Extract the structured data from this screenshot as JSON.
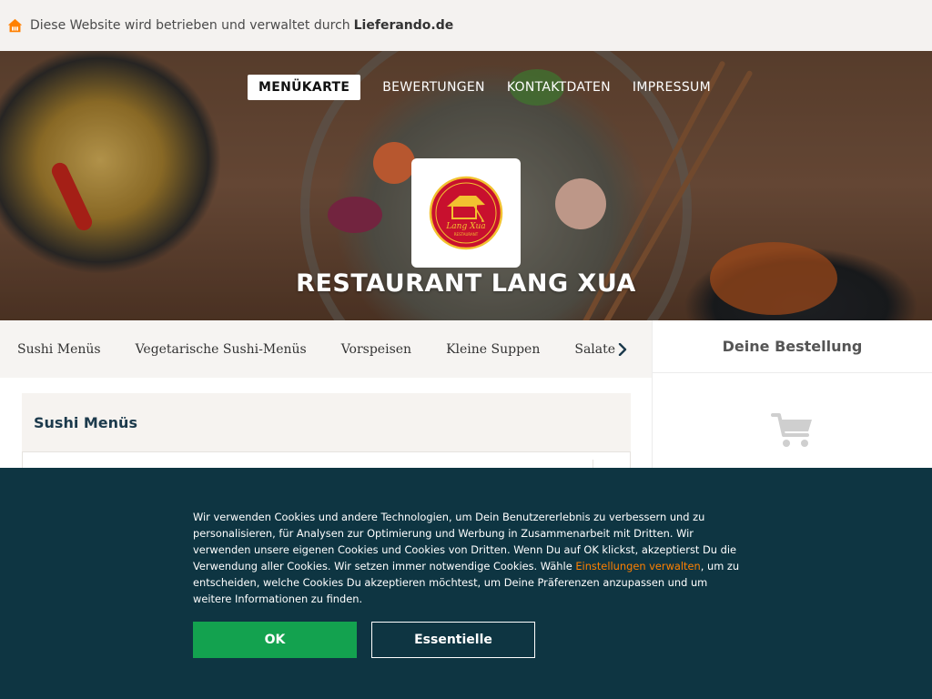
{
  "notice": {
    "text": "Diese Website wird betrieben und verwaltet durch",
    "brand": "Lieferando.de"
  },
  "nav": {
    "items": [
      "MENÜKARTE",
      "BEWERTUNGEN",
      "KONTAKTDATEN",
      "IMPRESSUM"
    ],
    "active_index": 0
  },
  "restaurant": {
    "name": "RESTAURANT LANG XUA"
  },
  "categories": [
    "Sushi Menüs",
    "Vegetarische Sushi-Menüs",
    "Vorspeisen",
    "Kleine Suppen",
    "Salate"
  ],
  "order": {
    "title": "Deine Bestellung"
  },
  "menu": {
    "section_title": "Sushi Menüs"
  },
  "cookie": {
    "text_before_link": "Wir verwenden Cookies und andere Technologien, um Dein Benutzererlebnis zu verbessern und zu personalisieren, für Analysen zur Optimierung und Werbung in Zusammenarbeit mit Dritten. Wir verwenden unsere eigenen Cookies und Cookies von Dritten. Wenn Du auf OK klickst, akzeptierst Du die Verwendung aller Cookies. Wir setzen immer notwendige Cookies. Wähle ",
    "link_text": "Einstellungen verwalten",
    "text_after_link": ", um zu entscheiden, welche Cookies Du akzeptieren möchtest, um Deine Präferenzen anzupassen und um weitere Informationen zu finden.",
    "ok_label": "OK",
    "essential_label": "Essentielle"
  },
  "colors": {
    "brand_orange": "#ff8000",
    "cookie_bg": "#0e3542",
    "ok_green": "#13a24f",
    "section_title": "#1c3a4c",
    "logo_red": "#c8102e",
    "logo_gold": "#f2c230"
  },
  "icons": {
    "notice": "house-icon",
    "category_next": "chevron-right-icon",
    "cart": "shopping-cart-icon"
  }
}
